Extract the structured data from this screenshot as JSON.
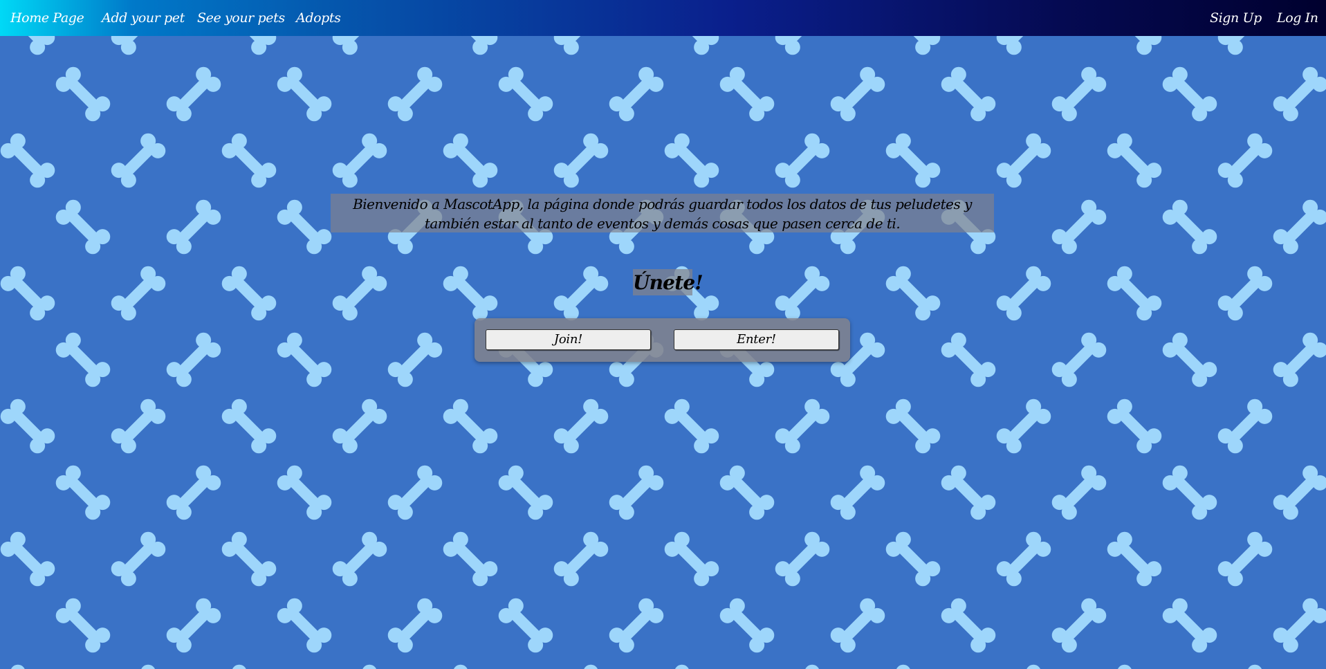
{
  "nav": {
    "home": "Home Page",
    "add_pet": "Add your pet",
    "see_pets": "See your pets",
    "adopts": "Adopts",
    "sign_up": "Sign Up",
    "log_in": "Log In"
  },
  "main": {
    "welcome_line1": "Bienvenido a MascotApp, la página donde podrás guardar todos los datos de tus peludetes y",
    "welcome_line2": "también estar al tanto de eventos y demás cosas que pasen cerca de ti.",
    "heading": "Únete!",
    "join_button": "Join!",
    "enter_button": "Enter!"
  },
  "colors": {
    "background": "#3a72c6",
    "bone": "#9ed6fb",
    "nav_gradient_start": "#00d9f6",
    "nav_gradient_end": "#00002e",
    "overlay": "#82828c"
  },
  "background_icon": "bone-icon"
}
